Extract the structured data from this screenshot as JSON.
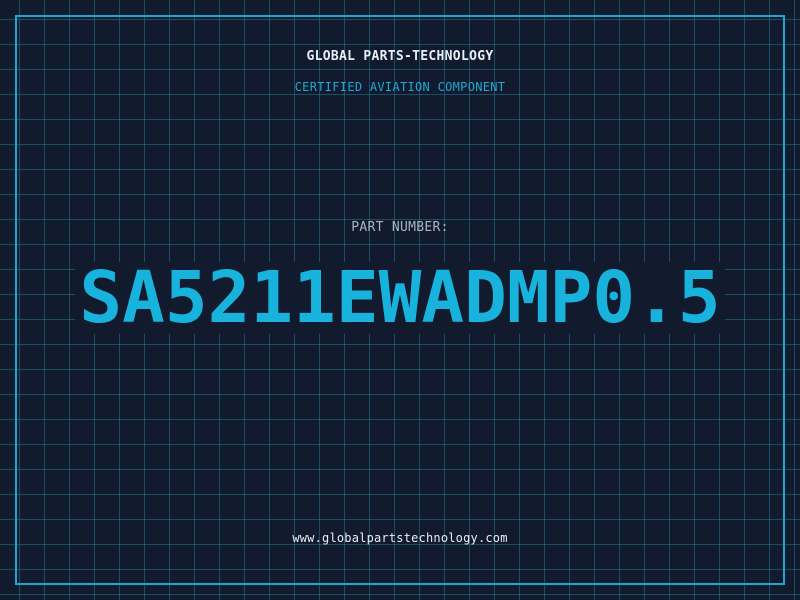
{
  "header": {
    "company": "GLOBAL PARTS-TECHNOLOGY",
    "tagline": "CERTIFIED AVIATION COMPONENT"
  },
  "part": {
    "label": "PART NUMBER:",
    "number": "SA5211EWADMP0.5"
  },
  "footer": {
    "website": "www.globalpartstechnology.com"
  },
  "colors": {
    "background": "#121a2e",
    "grid": "#2078966",
    "accent": "#18b3dc",
    "frame": "#1aa8d2",
    "text": "#e8eef5",
    "muted": "#a9b4c4"
  }
}
